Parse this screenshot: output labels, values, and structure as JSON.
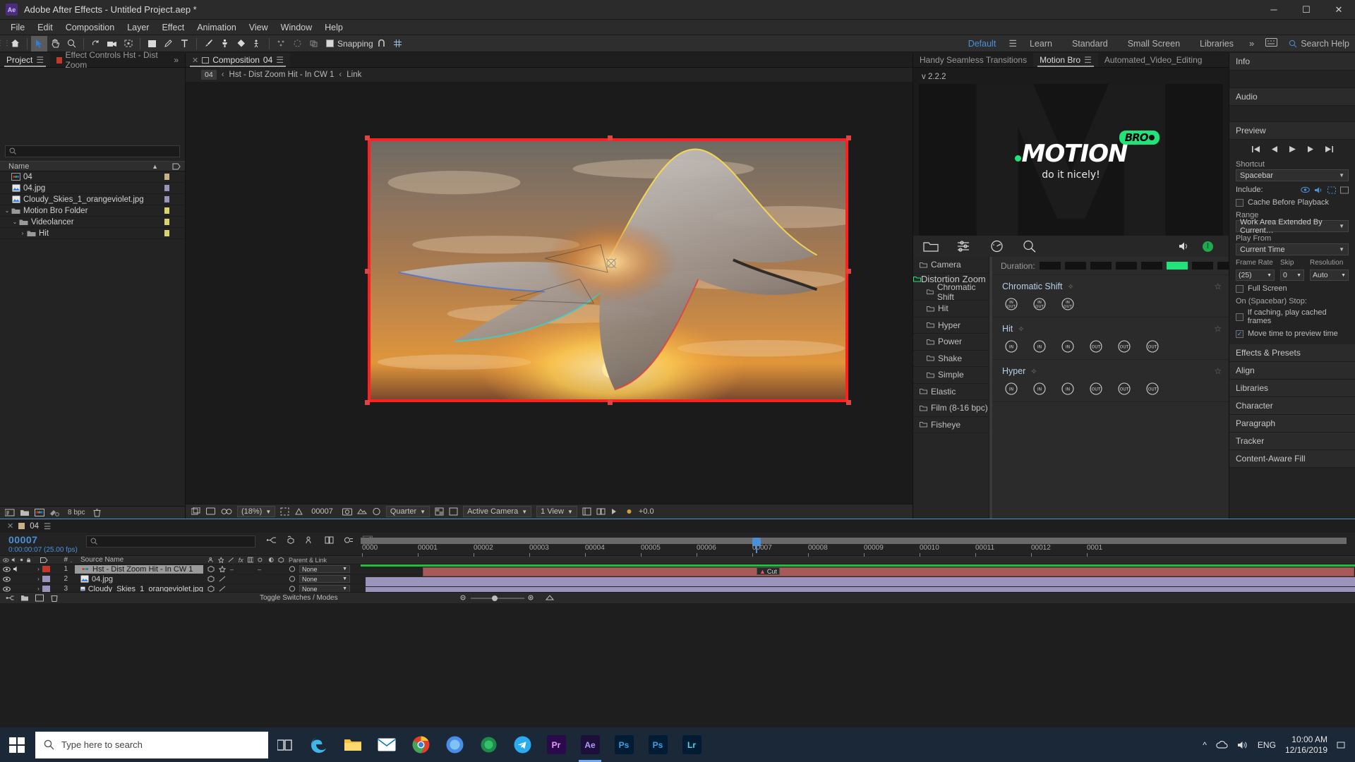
{
  "titlebar": {
    "app_icon": "ae-logo-icon",
    "title": "Adobe After Effects - Untitled Project.aep *",
    "minimize": "─",
    "maximize": "☐",
    "close": "✕"
  },
  "menubar": {
    "items": [
      "File",
      "Edit",
      "Composition",
      "Layer",
      "Effect",
      "Animation",
      "View",
      "Window",
      "Help"
    ]
  },
  "toolbar": {
    "snapping_label": "Snapping",
    "workspaces": [
      "Default",
      "Learn",
      "Standard",
      "Small Screen",
      "Libraries"
    ],
    "selected_workspace": "Default",
    "more": "»",
    "search_help": "Search Help"
  },
  "project": {
    "tabs": [
      {
        "label": "Project",
        "active": true
      },
      {
        "label": "Effect Controls Hst - Dist Zoom",
        "active": false
      }
    ],
    "tabs_more": "»",
    "search_placeholder": "",
    "column_header": "Name",
    "rows": [
      {
        "name": "04",
        "icon": "comp-icon",
        "indent": 0,
        "twirl": "",
        "label_color": "#c9b187"
      },
      {
        "name": "04.jpg",
        "icon": "image-icon",
        "indent": 0,
        "twirl": "",
        "label_color": "#9a94bd"
      },
      {
        "name": "Cloudy_Skies_1_orangeviolet.jpg",
        "icon": "image-icon",
        "indent": 0,
        "twirl": "",
        "label_color": "#9a94bd"
      },
      {
        "name": "Motion Bro Folder",
        "icon": "folder-icon",
        "indent": 0,
        "twirl": "⌄",
        "label_color": "#d9d46a"
      },
      {
        "name": "Videolancer",
        "icon": "folder-icon",
        "indent": 1,
        "twirl": "⌄",
        "label_color": "#d9d46a"
      },
      {
        "name": "Hit",
        "icon": "folder-icon",
        "indent": 2,
        "twirl": "›",
        "label_color": "#d9d46a"
      }
    ],
    "bpc": "8 bpc"
  },
  "composition": {
    "tab_label": "Composition",
    "tab_name": "04",
    "breadcrumb_num": "04",
    "breadcrumb_item": "Hst - Dist Zoom Hit - In CW 1",
    "breadcrumb_link": "Link",
    "zoom": "(18%)",
    "time": "00007",
    "resolution": "Quarter",
    "camera": "Active Camera",
    "views": "1 View",
    "exposure": "+0.0"
  },
  "motion_bro": {
    "tabs": [
      {
        "label": "Handy Seamless Transitions",
        "active": false
      },
      {
        "label": "Motion Bro",
        "active": true
      },
      {
        "label": "Automated_Video_Editing",
        "active": false
      }
    ],
    "version": "v 2.2.2",
    "logo_word": "MOTION",
    "logo_badge": "BRO",
    "logo_tagline": "do it nicely!",
    "toolbar_icons": [
      "folder-icon",
      "sliders-icon",
      "speedometer-icon",
      "search-icon",
      "speaker-icon",
      "info-icon"
    ],
    "info_badge": "!",
    "tree": [
      {
        "label": "Camera",
        "sub": false,
        "active": false
      },
      {
        "label": "Distortion Zoom",
        "sub": false,
        "active": true
      },
      {
        "label": "Chromatic Shift",
        "sub": true,
        "active": false
      },
      {
        "label": "Hit",
        "sub": true,
        "active": false
      },
      {
        "label": "Hyper",
        "sub": true,
        "active": false
      },
      {
        "label": "Power",
        "sub": true,
        "active": false
      },
      {
        "label": "Shake",
        "sub": true,
        "active": false
      },
      {
        "label": "Simple",
        "sub": true,
        "active": false
      },
      {
        "label": "Elastic",
        "sub": false,
        "active": false
      },
      {
        "label": "Film (8-16 bpc)",
        "sub": false,
        "active": false
      },
      {
        "label": "Fisheye",
        "sub": false,
        "active": false
      }
    ],
    "duration_label": "Duration:",
    "duration_segments": 8,
    "duration_active_index": 5,
    "groups": [
      {
        "title": "Chromatic Shift",
        "presets": [
          "IN/OUT",
          "IN/OUT",
          "IN/OUT"
        ]
      },
      {
        "title": "Hit",
        "presets": [
          "IN",
          "IN",
          "IN",
          "OUT",
          "OUT",
          "OUT"
        ]
      },
      {
        "title": "Hyper",
        "presets": [
          "IN",
          "IN",
          "IN",
          "OUT",
          "OUT",
          "OUT"
        ]
      }
    ]
  },
  "rail": {
    "sections": [
      "Info",
      "Audio",
      "Preview"
    ],
    "preview_label": "Preview",
    "shortcut_label": "Shortcut",
    "shortcut_value": "Spacebar",
    "include_label": "Include:",
    "cache_before_playback": "Cache Before Playback",
    "range_label": "Range",
    "range_value": "Work Area Extended By Current…",
    "play_from_label": "Play From",
    "play_from_value": "Current Time",
    "frame_rate_label": "Frame Rate",
    "frame_rate_value": "(25)",
    "skip_label": "Skip",
    "skip_value": "0",
    "resolution_label": "Resolution",
    "resolution_value": "Auto",
    "full_screen": "Full Screen",
    "on_stop_label": "On (Spacebar) Stop:",
    "if_caching": "If caching, play cached frames",
    "move_time": "Move time to preview time",
    "bottom_sections": [
      "Effects & Presets",
      "Align",
      "Libraries",
      "Character",
      "Paragraph",
      "Tracker",
      "Content-Aware Fill"
    ]
  },
  "timeline": {
    "tab_name": "04",
    "current_time": "00007",
    "current_time_sub": "0:00:00:07 (25.00 fps)",
    "search_placeholder": "",
    "columns": {
      "source_name": "Source Name",
      "num": "#",
      "parent": "Parent & Link"
    },
    "layers": [
      {
        "num": "1",
        "name": "Hst - Dist Zoom Hit - In CW 1",
        "color": "#c0392b",
        "parent": "None",
        "selected": true,
        "icon": "comp-icon"
      },
      {
        "num": "2",
        "name": "04.jpg",
        "color": "#9a94bd",
        "parent": "None",
        "selected": false,
        "icon": "image-icon"
      },
      {
        "num": "3",
        "name": "Cloudy_Skies_1_orangeviolet.jpg",
        "color": "#9a94bd",
        "parent": "None",
        "selected": false,
        "icon": "image-icon"
      }
    ],
    "ruler_ticks": [
      "0000",
      "00001",
      "00002",
      "00003",
      "00004",
      "00005",
      "00006",
      "00007",
      "00008",
      "00009",
      "00010",
      "00011",
      "00012",
      "0001"
    ],
    "cut_marker": "Cut",
    "toggle_switches": "Toggle Switches / Modes"
  },
  "taskbar": {
    "search_placeholder": "Type here to search",
    "apps": [
      "task-view-icon",
      "edge-icon",
      "file-explorer-icon",
      "mail-icon",
      "chrome-icon",
      "firefox-icon",
      "store-icon",
      "telegram-icon",
      "Pr",
      "Ae",
      "Ps",
      "Ps",
      "Lr"
    ],
    "active_app": "Ae",
    "language": "ENG",
    "time": "10:00 AM",
    "date": "12/16/2019"
  }
}
